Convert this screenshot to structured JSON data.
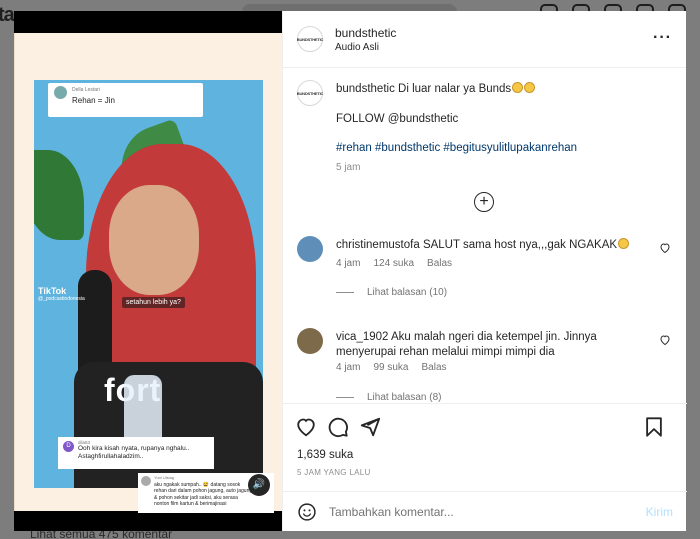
{
  "background": {
    "logo_fragment": "ta",
    "view_all_comments": "Lihat semua 475 komentar"
  },
  "media": {
    "top_note": {
      "name": "Della Lestari",
      "text": "Rehan = Jin"
    },
    "tiktok": {
      "name": "TikTok",
      "handle": "@_podcastindonesia"
    },
    "caption": "setahun lebih ya?",
    "shirt_text": "fort",
    "overlay_comment_1": {
      "avatar_letter": "D",
      "name": "dila83",
      "lines": [
        "Ooh kira kisah nyata, rupanya nghalu..",
        "Astaghfirullahaladzim.."
      ]
    },
    "overlay_comment_2": {
      "name": "Yuni Ulsiag",
      "lines": [
        "aku ngakak sumpah.. 😅 datang sosok",
        "rehan dari dalam pohon jagung, auto jagung",
        "& pohon sekitar jadi saksi, aku serasa",
        "nonton film kartun & berimajinasi"
      ]
    },
    "sound_icon": "speaker-icon"
  },
  "post": {
    "username": "bundsthetic",
    "audio": "Audio Asli",
    "avatar_text": "BUNDSTHETIC",
    "caption": {
      "username": "bundsthetic",
      "line1": "Di luar nalar ya Bunds",
      "line2": "FOLLOW @bundsthetic",
      "line3": "#rehan #bundsthetic #begitusyulitlupakanrehan",
      "time": "5 jam"
    },
    "load_more_icon": "plus-circle-icon",
    "comments": [
      {
        "username": "christinemustofa",
        "text": "SALUT sama host nya,,,gak NGAKAK",
        "time": "4 jam",
        "likes": "124 suka",
        "reply": "Balas",
        "view_replies": "Lihat balasan (10)",
        "avatar_color": "#5f8fb8"
      },
      {
        "username": "vica_1902",
        "text": "Aku malah ngeri dia ketempel jin. Jinnya menyerupai rehan melalui mimpi mimpi dia",
        "time": "4 jam",
        "likes": "99 suka",
        "reply": "Balas",
        "view_replies": "Lihat balasan (8)",
        "avatar_color": "#7d6a4a"
      }
    ],
    "likes": "1,639 suka",
    "date": "5 JAM YANG LALU",
    "add_comment": {
      "placeholder": "Tambahkan komentar...",
      "post_label": "Kirim"
    },
    "colors": {
      "link": "#00376b",
      "post_button_disabled": "#b2dffc",
      "muted": "#737373"
    }
  }
}
